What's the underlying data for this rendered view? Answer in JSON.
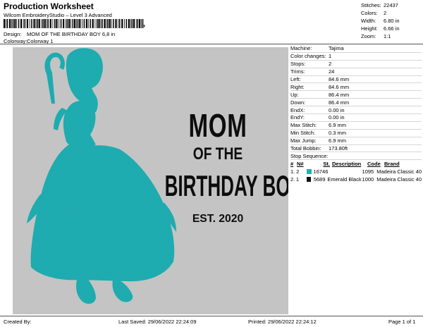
{
  "header": {
    "title": "Production Worksheet",
    "software": "Wilcom EmbroideryStudio – Level 3 Advanced",
    "design_label": "Design:",
    "design_value": "MOM OF THE BIRTHDAY BOY 6,8 in",
    "colorway_label": "Colorway:",
    "colorway_value": "Colorway 1"
  },
  "stats": [
    {
      "label": "Stitches:",
      "value": "22437"
    },
    {
      "label": "Colors:",
      "value": "2"
    },
    {
      "label": "Width:",
      "value": "6.80 in"
    },
    {
      "label": "Height:",
      "value": "6.66 in"
    },
    {
      "label": "Zoom:",
      "value": "1:1"
    }
  ],
  "machine_info": [
    {
      "label": "Machine:",
      "value": "Tajima"
    },
    {
      "label": "Color changes:",
      "value": "1"
    },
    {
      "label": "Stops:",
      "value": "2"
    },
    {
      "label": "Trims:",
      "value": "24"
    },
    {
      "label": "Left:",
      "value": "84.6 mm"
    },
    {
      "label": "Right:",
      "value": "84.6 mm"
    },
    {
      "label": "Up:",
      "value": "86.4 mm"
    },
    {
      "label": "Down:",
      "value": "86.4 mm"
    },
    {
      "label": "EndX:",
      "value": "0.00 in"
    },
    {
      "label": "EndY:",
      "value": "0.00 in"
    },
    {
      "label": "Max Stitch:",
      "value": "6.9 mm"
    },
    {
      "label": "Min Stitch:",
      "value": "0.3 mm"
    },
    {
      "label": "Max Jump:",
      "value": "6.9 mm"
    },
    {
      "label": "Total Bobbin:",
      "value": "173.80ft"
    }
  ],
  "stop_sequence": {
    "label": "Stop Sequence:",
    "headers": [
      "#",
      "N#",
      "St.",
      "Description",
      "Code",
      "Brand"
    ],
    "rows": [
      {
        "num": "1.",
        "n": "2",
        "color": "#1fb0b4",
        "stitches": "16746",
        "description": "",
        "code": "1095",
        "brand": "Madeira Classic 40"
      },
      {
        "num": "2.",
        "n": "1",
        "color": "#111111",
        "stitches": "5689",
        "description": "Emerald Black",
        "code": "1000",
        "brand": "Madeira Classic 40"
      }
    ]
  },
  "design_text": {
    "line1": "MOM",
    "line2": "OF THE",
    "line3": "BIRTHDAY BOY",
    "line4": "EST. 2020"
  },
  "footer": {
    "created_by": "Created By:",
    "last_saved": "Last Saved: 29/06/2022 22:24:09",
    "printed": "Printed: 29/06/2022 22:24:12",
    "page": "Page 1 of 1"
  },
  "colors": {
    "canvas": "#c4c4c4",
    "silhouette": "#1fb0b4",
    "text": "#111111"
  }
}
